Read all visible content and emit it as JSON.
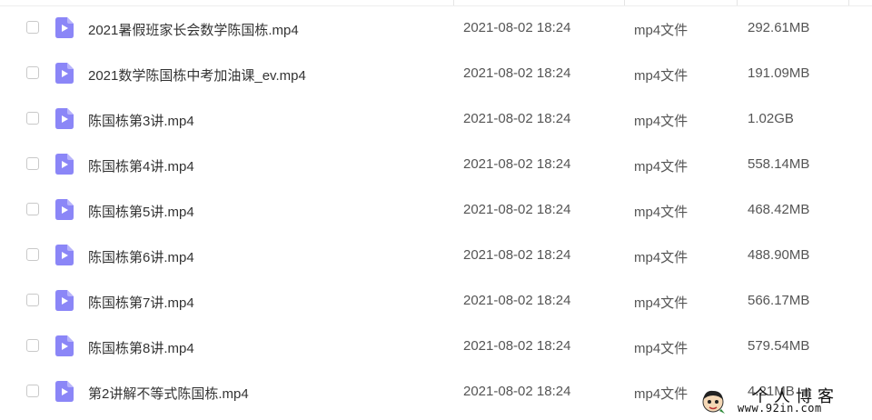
{
  "files": [
    {
      "name": "2021暑假班家长会数学陈国栋.mp4",
      "modified": "2021-08-02 18:24",
      "type": "mp4文件",
      "size": "292.61MB"
    },
    {
      "name": "2021数学陈国栋中考加油课_ev.mp4",
      "modified": "2021-08-02 18:24",
      "type": "mp4文件",
      "size": "191.09MB"
    },
    {
      "name": "陈国栋第3讲.mp4",
      "modified": "2021-08-02 18:24",
      "type": "mp4文件",
      "size": "1.02GB"
    },
    {
      "name": "陈国栋第4讲.mp4",
      "modified": "2021-08-02 18:24",
      "type": "mp4文件",
      "size": "558.14MB"
    },
    {
      "name": "陈国栋第5讲.mp4",
      "modified": "2021-08-02 18:24",
      "type": "mp4文件",
      "size": "468.42MB"
    },
    {
      "name": "陈国栋第6讲.mp4",
      "modified": "2021-08-02 18:24",
      "type": "mp4文件",
      "size": "488.90MB"
    },
    {
      "name": "陈国栋第7讲.mp4",
      "modified": "2021-08-02 18:24",
      "type": "mp4文件",
      "size": "566.17MB"
    },
    {
      "name": "陈国栋第8讲.mp4",
      "modified": "2021-08-02 18:24",
      "type": "mp4文件",
      "size": "579.54MB"
    },
    {
      "name": "第2讲解不等式陈国栋.mp4",
      "modified": "2021-08-02 18:24",
      "type": "mp4文件",
      "size": "4.21MB"
    }
  ],
  "icon": {
    "name": "video-file-icon",
    "color": "#8b86f7"
  },
  "watermark": {
    "title": "个人博客",
    "url": "www.92in.com"
  }
}
